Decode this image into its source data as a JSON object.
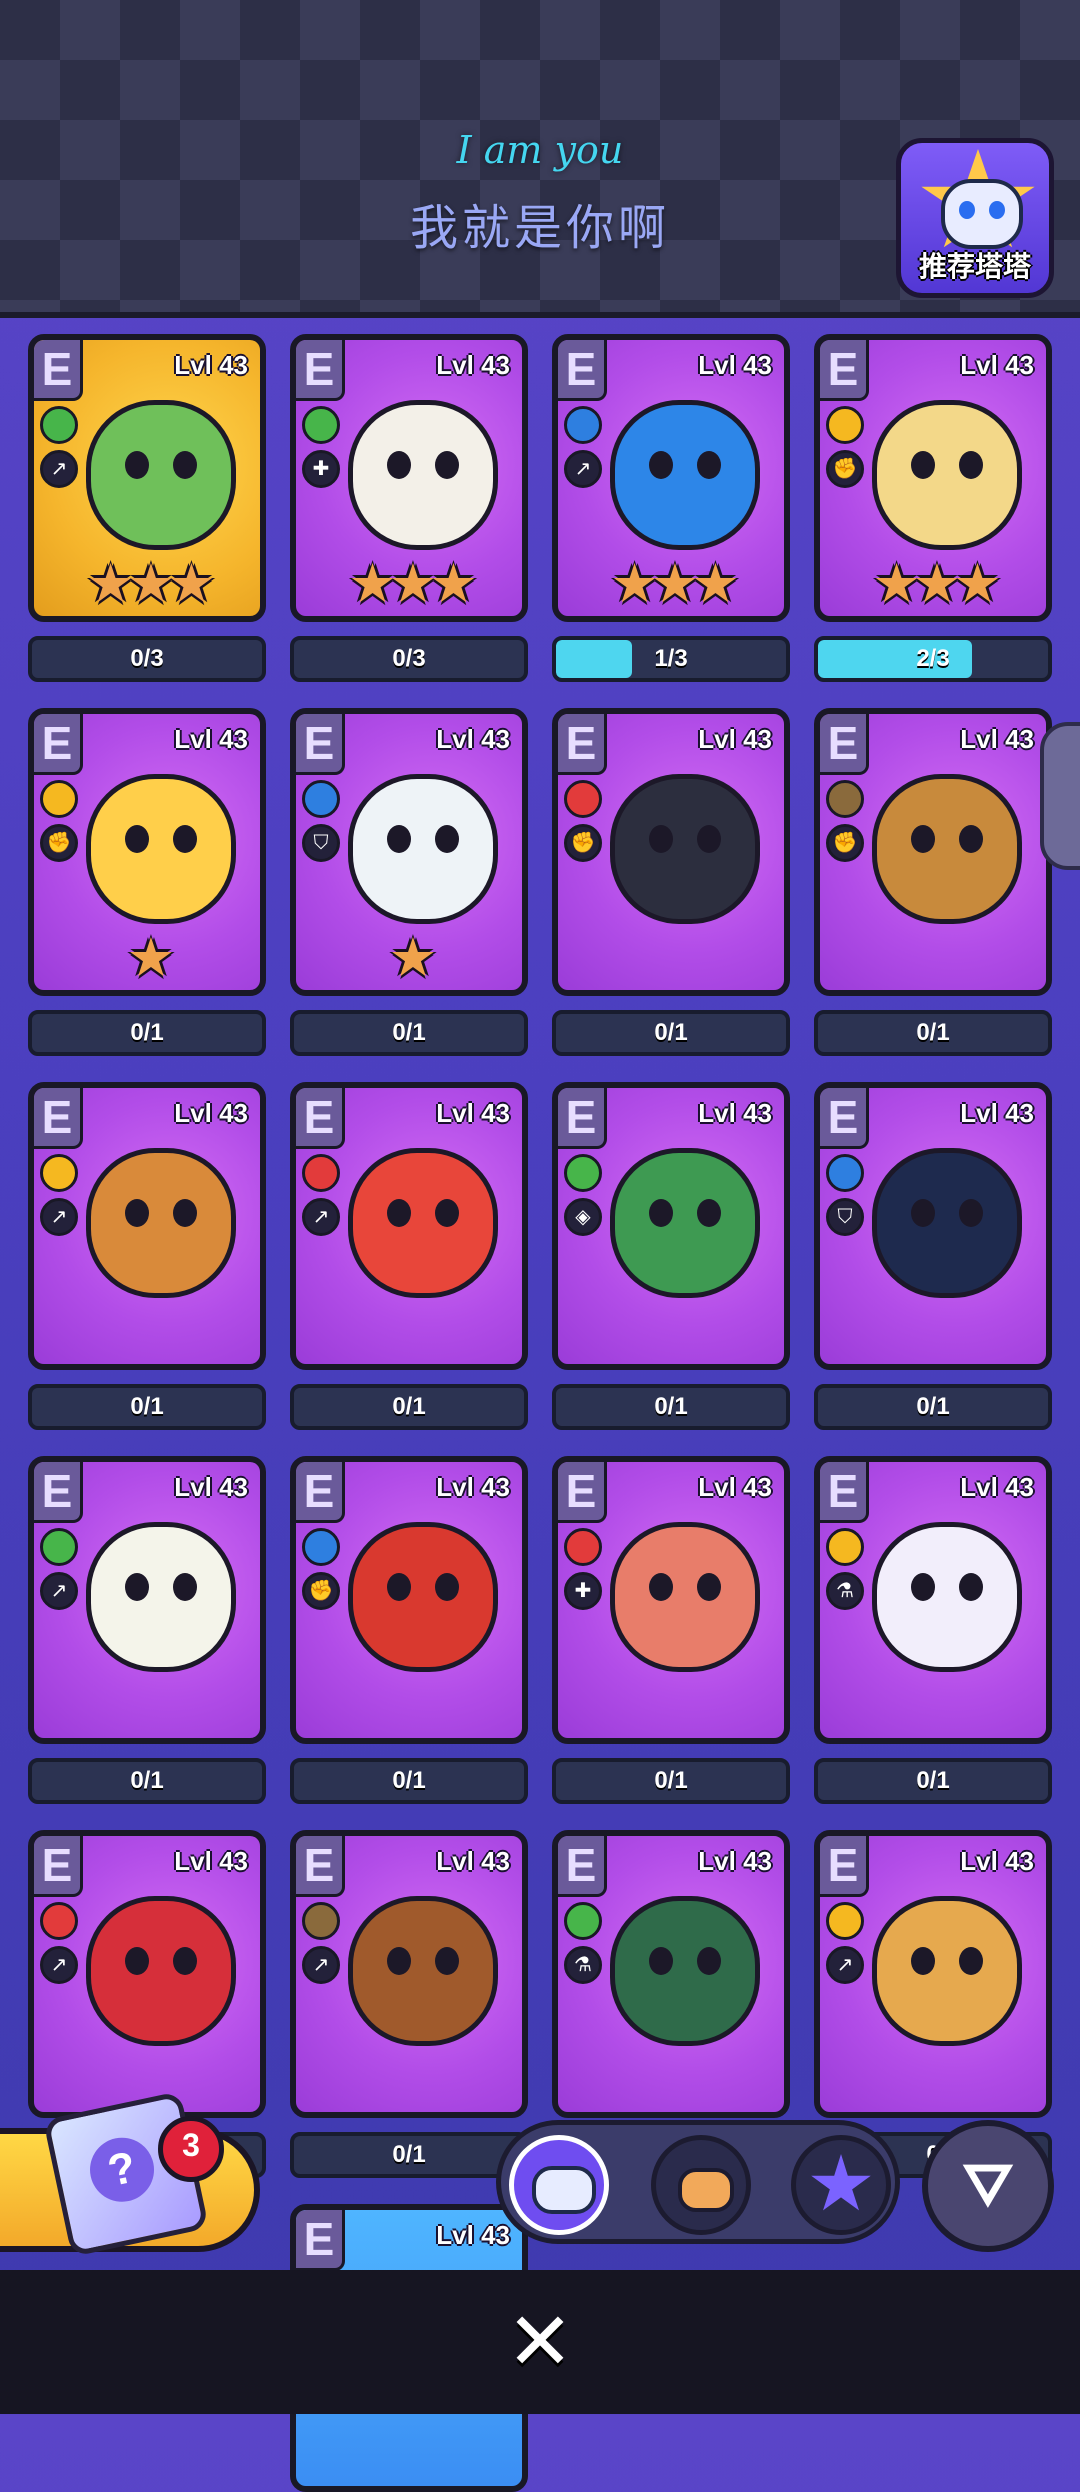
{
  "header": {
    "subtitle_en": "I am you",
    "subtitle_cn": "我就是你啊",
    "recommend_label": "推荐塔塔"
  },
  "cards": [
    {
      "grade": "E",
      "level": "Lvl 43",
      "element": "leaf",
      "role": "sword",
      "stars": 3,
      "progress": "0/3",
      "progress_value": 0,
      "bg": "gold",
      "creature_color": "#6fc05a"
    },
    {
      "grade": "E",
      "level": "Lvl 43",
      "element": "leaf",
      "role": "heal",
      "stars": 3,
      "progress": "0/3",
      "progress_value": 0,
      "bg": "purple",
      "creature_color": "#f3f0e8"
    },
    {
      "grade": "E",
      "level": "Lvl 43",
      "element": "water",
      "role": "sword",
      "stars": 3,
      "progress": "1/3",
      "progress_value": 0.33,
      "bg": "purple",
      "creature_color": "#2d86e8"
    },
    {
      "grade": "E",
      "level": "Lvl 43",
      "element": "lightning",
      "role": "fist",
      "stars": 3,
      "progress": "2/3",
      "progress_value": 0.67,
      "bg": "purple",
      "creature_color": "#f3d889"
    },
    {
      "grade": "E",
      "level": "Lvl 43",
      "element": "lightning",
      "role": "fist",
      "stars": 1,
      "progress": "0/1",
      "progress_value": 0,
      "bg": "purple",
      "creature_color": "#ffcf4a"
    },
    {
      "grade": "E",
      "level": "Lvl 43",
      "element": "water",
      "role": "shield",
      "stars": 1,
      "progress": "0/1",
      "progress_value": 0,
      "bg": "purple",
      "creature_color": "#eef3f7"
    },
    {
      "grade": "E",
      "level": "Lvl 43",
      "element": "fire",
      "role": "fist",
      "stars": 0,
      "progress": "0/1",
      "progress_value": 0,
      "bg": "purple",
      "creature_color": "#2c2e3e"
    },
    {
      "grade": "E",
      "level": "Lvl 43",
      "element": "earth",
      "role": "fist",
      "stars": 0,
      "progress": "0/1",
      "progress_value": 0,
      "bg": "purple",
      "creature_color": "#c88a3c"
    },
    {
      "grade": "E",
      "level": "Lvl 43",
      "element": "lightning",
      "role": "sword",
      "stars": 0,
      "progress": "0/1",
      "progress_value": 0,
      "bg": "purple",
      "creature_color": "#d98a3a"
    },
    {
      "grade": "E",
      "level": "Lvl 43",
      "element": "fire",
      "role": "sword",
      "stars": 0,
      "progress": "0/1",
      "progress_value": 0,
      "bg": "purple",
      "creature_color": "#e8463a"
    },
    {
      "grade": "E",
      "level": "Lvl 43",
      "element": "leaf",
      "role": "eye",
      "stars": 0,
      "progress": "0/1",
      "progress_value": 0,
      "bg": "purple",
      "creature_color": "#3e9a52"
    },
    {
      "grade": "E",
      "level": "Lvl 43",
      "element": "water",
      "role": "shield",
      "stars": 0,
      "progress": "0/1",
      "progress_value": 0,
      "bg": "purple",
      "creature_color": "#1e2a4e"
    },
    {
      "grade": "E",
      "level": "Lvl 43",
      "element": "leaf",
      "role": "sword",
      "stars": 0,
      "progress": "0/1",
      "progress_value": 0,
      "bg": "purple",
      "creature_color": "#f4f4ea"
    },
    {
      "grade": "E",
      "level": "Lvl 43",
      "element": "water",
      "role": "fist",
      "stars": 0,
      "progress": "0/1",
      "progress_value": 0,
      "bg": "purple",
      "creature_color": "#d9392f"
    },
    {
      "grade": "E",
      "level": "Lvl 43",
      "element": "fire",
      "role": "heal",
      "stars": 0,
      "progress": "0/1",
      "progress_value": 0,
      "bg": "purple",
      "creature_color": "#e87d6a"
    },
    {
      "grade": "E",
      "level": "Lvl 43",
      "element": "lightning",
      "role": "flask",
      "stars": 0,
      "progress": "0/1",
      "progress_value": 0,
      "bg": "purple",
      "creature_color": "#f2eefb"
    },
    {
      "grade": "E",
      "level": "Lvl 43",
      "element": "fire",
      "role": "sword",
      "stars": 0,
      "progress": "",
      "progress_value": 0,
      "bg": "purple",
      "creature_color": "#d62f3a"
    },
    {
      "grade": "E",
      "level": "Lvl 43",
      "element": "earth",
      "role": "sword",
      "stars": 0,
      "progress": "0/1",
      "progress_value": 0,
      "bg": "purple",
      "creature_color": "#a05a2c"
    },
    {
      "grade": "E",
      "level": "Lvl 43",
      "element": "leaf",
      "role": "flask",
      "stars": 0,
      "progress": "",
      "progress_value": 0,
      "bg": "purple",
      "creature_color": "#2f6b4a"
    },
    {
      "grade": "E",
      "level": "Lvl 43",
      "element": "lightning",
      "role": "sword",
      "stars": 0,
      "progress": "0",
      "progress_value": 0,
      "bg": "purple",
      "creature_color": "#e6a94e"
    },
    {
      "grade": "E",
      "level": "Lvl 43",
      "element": "",
      "role": "",
      "stars": 0,
      "progress": "",
      "progress_value": 0,
      "bg": "blue",
      "creature_color": ""
    }
  ],
  "element_colors": {
    "leaf": "#47b54a",
    "water": "#2e7fe0",
    "lightning": "#f5b820",
    "fire": "#e23b3b",
    "earth": "#8a6a3c"
  },
  "role_glyphs": {
    "sword": "↗",
    "heal": "✚",
    "fist": "✊",
    "shield": "⛉",
    "eye": "◈",
    "flask": "⚗"
  },
  "bottom": {
    "gift_badge": "3",
    "gift_icon": "?",
    "tabs": [
      {
        "name": "robot-tab",
        "selected": true
      },
      {
        "name": "bread-tab",
        "selected": false
      },
      {
        "name": "star-tab",
        "selected": false
      }
    ],
    "filter_icon": "filter-icon",
    "close_icon": "✕"
  }
}
